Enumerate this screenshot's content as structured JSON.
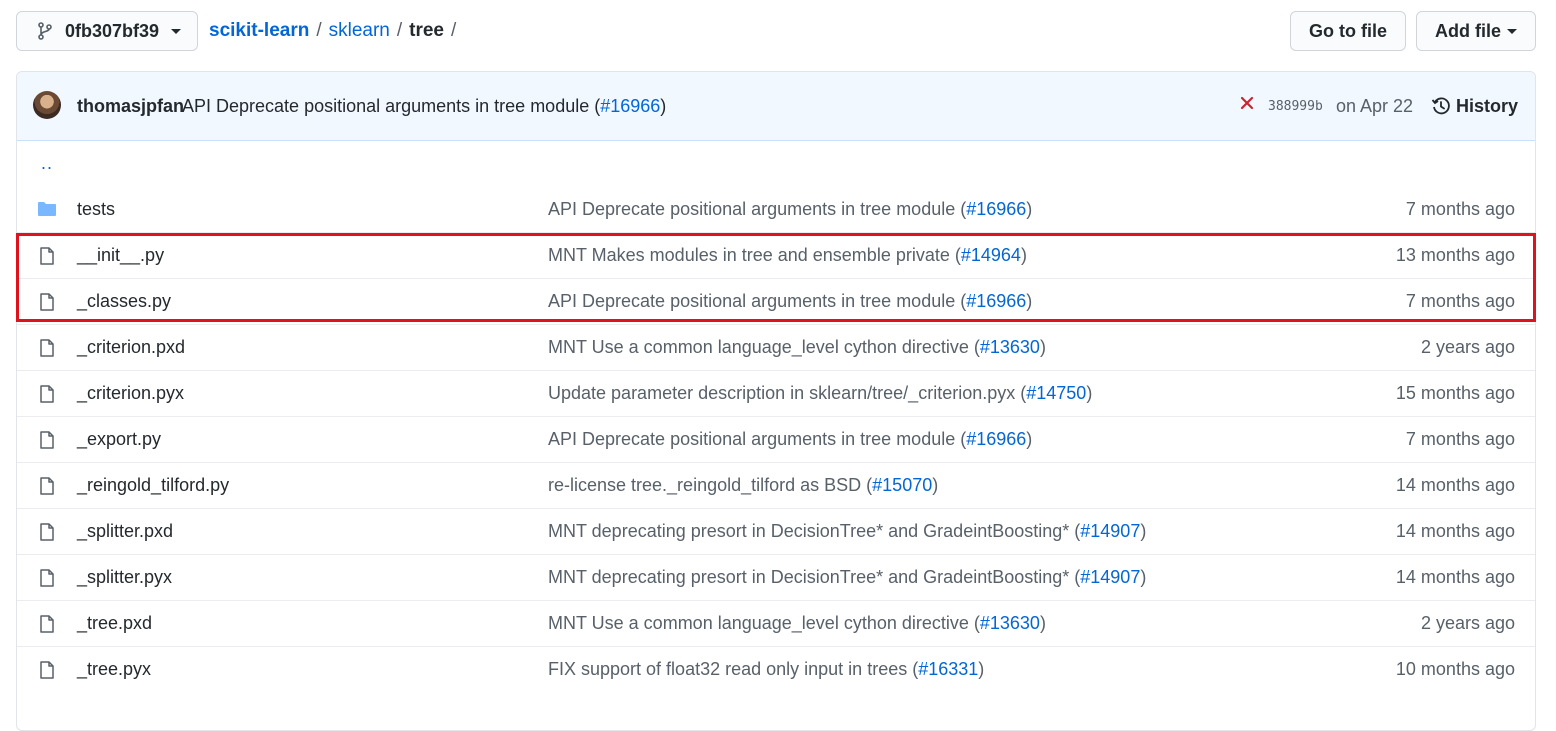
{
  "toolbar": {
    "branch": "0fb307bf39",
    "breadcrumb": {
      "repo": "scikit-learn",
      "folder1": "sklearn",
      "folder2": "tree",
      "sep1": "/",
      "sep2": "/",
      "sep3": "/"
    },
    "goto_label": "Go to file",
    "add_label": "Add file"
  },
  "commit": {
    "author": "thomasjpfan",
    "message": "API Deprecate positional arguments in tree module (",
    "pr": "#16966",
    "message_end": ")",
    "status_icon": "x-icon",
    "sha": "388999b",
    "date": "on Apr 22",
    "history_label": "History"
  },
  "parent_link": "..",
  "files": [
    {
      "type": "folder",
      "name": "tests",
      "msg": "API Deprecate positional arguments in tree module (",
      "pr": "#16966",
      "msg_end": ")",
      "age": "7 months ago"
    },
    {
      "type": "file",
      "name": "__init__.py",
      "msg": "MNT Makes modules in tree and ensemble private (",
      "pr": "#14964",
      "msg_end": ")",
      "age": "13 months ago"
    },
    {
      "type": "file",
      "name": "_classes.py",
      "msg": "API Deprecate positional arguments in tree module (",
      "pr": "#16966",
      "msg_end": ")",
      "age": "7 months ago"
    },
    {
      "type": "file",
      "name": "_criterion.pxd",
      "msg": "MNT Use a common language_level cython directive (",
      "pr": "#13630",
      "msg_end": ")",
      "age": "2 years ago"
    },
    {
      "type": "file",
      "name": "_criterion.pyx",
      "msg": "Update parameter description in sklearn/tree/_criterion.pyx (",
      "pr": "#14750",
      "msg_end": ")",
      "age": "15 months ago"
    },
    {
      "type": "file",
      "name": "_export.py",
      "msg": "API Deprecate positional arguments in tree module (",
      "pr": "#16966",
      "msg_end": ")",
      "age": "7 months ago"
    },
    {
      "type": "file",
      "name": "_reingold_tilford.py",
      "msg": "re-license tree._reingold_tilford as BSD (",
      "pr": "#15070",
      "msg_end": ")",
      "age": "14 months ago"
    },
    {
      "type": "file",
      "name": "_splitter.pxd",
      "msg": "MNT deprecating presort in DecisionTree* and GradeintBoosting* (",
      "pr": "#14907",
      "msg_end": ")",
      "age": "14 months ago"
    },
    {
      "type": "file",
      "name": "_splitter.pyx",
      "msg": "MNT deprecating presort in DecisionTree* and GradeintBoosting* (",
      "pr": "#14907",
      "msg_end": ")",
      "age": "14 months ago"
    },
    {
      "type": "file",
      "name": "_tree.pxd",
      "msg": "MNT Use a common language_level cython directive (",
      "pr": "#13630",
      "msg_end": ")",
      "age": "2 years ago"
    },
    {
      "type": "file",
      "name": "_tree.pyx",
      "msg": "FIX support of float32 read only input in trees (",
      "pr": "#16331",
      "msg_end": ")",
      "age": "10 months ago"
    }
  ],
  "colors": {
    "link": "#0366d6",
    "highlight": "#e0121c",
    "error": "#cb2431",
    "folder": "#79b8ff"
  }
}
